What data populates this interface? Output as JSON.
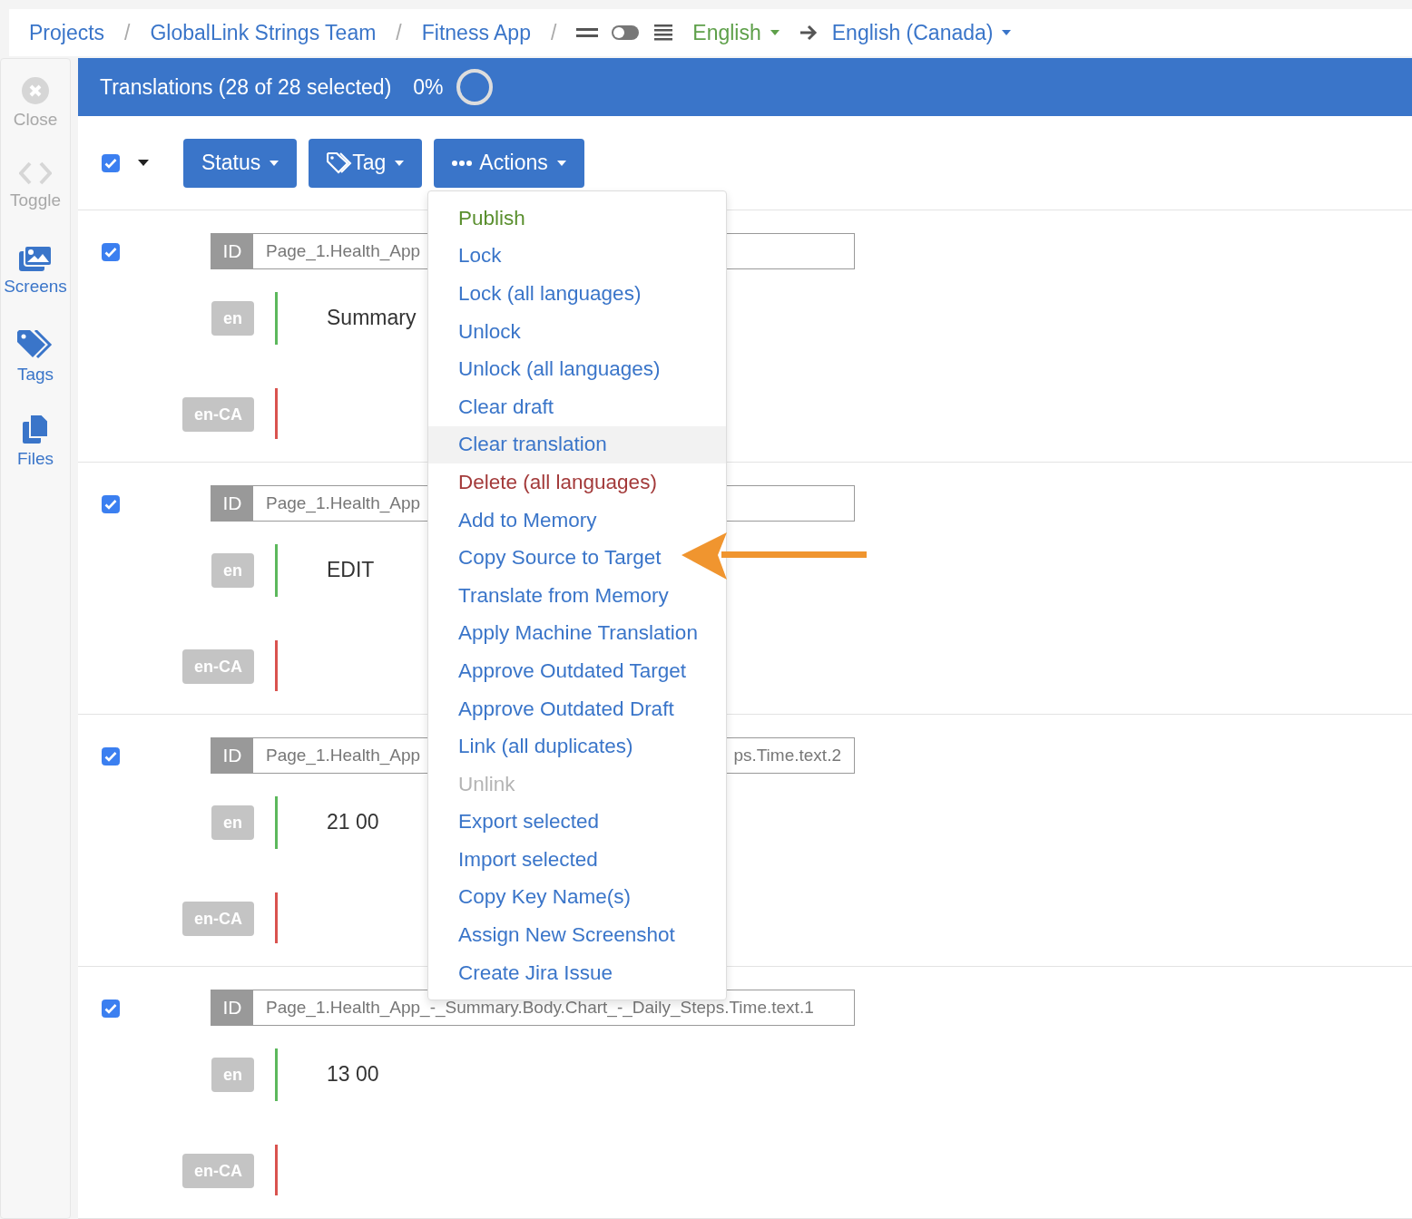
{
  "breadcrumbs": [
    {
      "label": "Projects",
      "separator": "/"
    },
    {
      "label": "GlobalLink Strings Team",
      "separator": "/"
    },
    {
      "label": "Fitness App",
      "separator": "/"
    }
  ],
  "view_toggle": {
    "on": false
  },
  "source_language": {
    "label": "English"
  },
  "target_language": {
    "label": "English (Canada)"
  },
  "sidebar": {
    "items": [
      {
        "label": "Close",
        "disabled": true
      },
      {
        "label": "Toggle",
        "disabled": true
      },
      {
        "label": "Screens",
        "disabled": false
      },
      {
        "label": "Tags",
        "disabled": false
      },
      {
        "label": "Files",
        "disabled": false
      }
    ]
  },
  "header": {
    "title": "Translations (28 of 28 selected)",
    "progress_text": "0%"
  },
  "toolbar": {
    "select_all": {
      "checked": true
    },
    "buttons": [
      {
        "label": "Status"
      },
      {
        "label": "Tag"
      },
      {
        "label": "Actions"
      }
    ]
  },
  "rows": [
    {
      "checked": true,
      "id_label": "ID",
      "id_start": "Page_1.Health_App",
      "source_lang": "en",
      "source_text": "Summary",
      "target_lang": "en-CA"
    },
    {
      "checked": true,
      "id_label": "ID",
      "id_start": "Page_1.Health_App",
      "source_lang": "en",
      "source_text": "EDIT",
      "target_lang": "en-CA"
    },
    {
      "checked": true,
      "id_label": "ID",
      "id_start": "Page_1.Health_App",
      "id_end": "ps.Time.text.2",
      "source_lang": "en",
      "source_text": "21 00",
      "target_lang": "en-CA"
    },
    {
      "checked": true,
      "id_label": "ID",
      "id_start": "Page_1.Health_App_-_Summary.Body.Chart_-_Daily_Steps.Time.text.1",
      "source_lang": "en",
      "source_text": "13 00",
      "target_lang": "en-CA"
    }
  ],
  "actions_menu": {
    "items": [
      {
        "label": "Publish",
        "kind": "success",
        "highlighted": false
      },
      {
        "label": "Lock",
        "kind": "normal",
        "highlighted": false
      },
      {
        "label": "Lock (all languages)",
        "kind": "normal",
        "highlighted": false
      },
      {
        "label": "Unlock",
        "kind": "normal",
        "highlighted": false
      },
      {
        "label": "Unlock (all languages)",
        "kind": "normal",
        "highlighted": false
      },
      {
        "label": "Clear draft",
        "kind": "normal",
        "highlighted": false
      },
      {
        "label": "Clear translation",
        "kind": "normal",
        "highlighted": true
      },
      {
        "label": "Delete (all languages)",
        "kind": "danger",
        "highlighted": false
      },
      {
        "label": "Add to Memory",
        "kind": "normal",
        "highlighted": false
      },
      {
        "label": "Copy Source to Target",
        "kind": "normal",
        "highlighted": false
      },
      {
        "label": "Translate from Memory",
        "kind": "normal",
        "highlighted": false
      },
      {
        "label": "Apply Machine Translation",
        "kind": "normal",
        "highlighted": false
      },
      {
        "label": "Approve Outdated Target",
        "kind": "normal",
        "highlighted": false
      },
      {
        "label": "Approve Outdated Draft",
        "kind": "normal",
        "highlighted": false
      },
      {
        "label": "Link (all duplicates)",
        "kind": "normal",
        "highlighted": false
      },
      {
        "label": "Unlink",
        "kind": "disabled",
        "highlighted": false
      },
      {
        "label": "Export selected",
        "kind": "normal",
        "highlighted": false
      },
      {
        "label": "Import selected",
        "kind": "normal",
        "highlighted": false
      },
      {
        "label": "Copy Key Name(s)",
        "kind": "normal",
        "highlighted": false
      },
      {
        "label": "Assign New Screenshot",
        "kind": "normal",
        "highlighted": false
      },
      {
        "label": "Create Jira Issue",
        "kind": "normal",
        "highlighted": false
      }
    ]
  }
}
